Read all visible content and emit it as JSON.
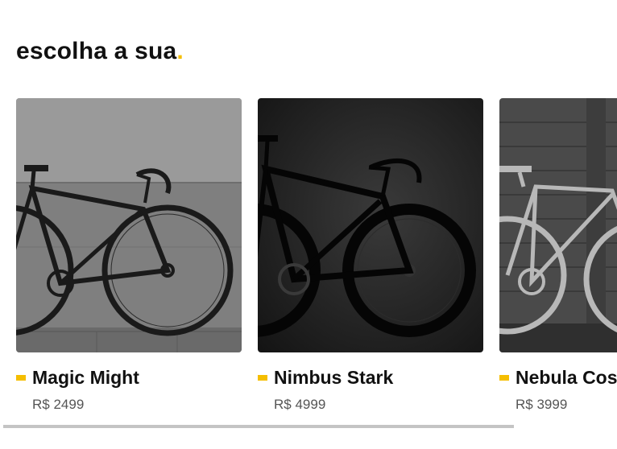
{
  "section": {
    "title": "escolha a sua",
    "title_dot": ".",
    "accent_color": "#f5be00"
  },
  "products": [
    {
      "name": "Magic Might",
      "price": "R$ 2499",
      "image": "bicycle-photo-grey-wall"
    },
    {
      "name": "Nimbus Stark",
      "price": "R$ 4999",
      "image": "bicycle-photo-dark-studio"
    },
    {
      "name": "Nebula Cosmic",
      "price": "R$ 3999",
      "image": "bicycle-photo-light-frame-wood-wall"
    }
  ],
  "carousel": {
    "scroll_position": 0
  }
}
